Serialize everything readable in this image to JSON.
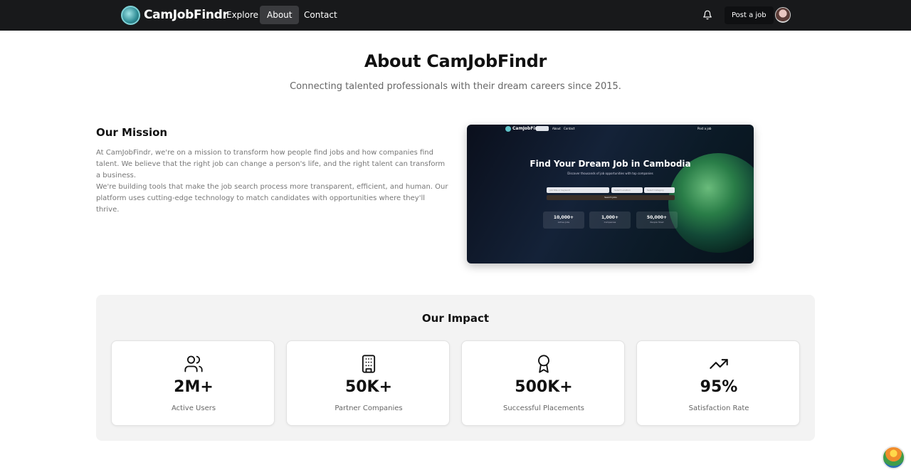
{
  "nav": {
    "brand": "CamJobFindr",
    "links": [
      "Explore",
      "About",
      "Contact"
    ],
    "post_job": "Post a job"
  },
  "header": {
    "title": "About CamJobFindr",
    "subtitle": "Connecting talented professionals with their dream careers since 2015."
  },
  "mission": {
    "heading": "Our Mission",
    "paragraphs": [
      "At CamJobFindr, we're on a mission to transform how people find jobs and how companies find talent. We believe that the right job can change a person's life, and the right talent can transform a business.",
      "We're building tools that make the job search process more transparent, efficient, and human. Our platform uses cutting-edge technology to match candidates with opportunities where they'll thrive."
    ]
  },
  "preview": {
    "brand": "CamJobFindr",
    "nav_links": [
      "About",
      "Contact"
    ],
    "post_job": "Post a job",
    "hero_title": "Find Your Dream Job in Cambodia",
    "hero_subtitle": "Discover thousands of job opportunities with top companies",
    "search_placeholder": "Job title or keyword",
    "location_select": "Select Location",
    "category_select": "Select Category",
    "search_button": "Search Jobs",
    "stats": [
      {
        "value": "10,000+",
        "label": "Active Jobs"
      },
      {
        "value": "1,000+",
        "label": "Companies"
      },
      {
        "value": "50,000+",
        "label": "People Hired"
      }
    ]
  },
  "impact": {
    "heading": "Our Impact",
    "stats": [
      {
        "icon": "users-icon",
        "value": "2M+",
        "label": "Active Users"
      },
      {
        "icon": "building-icon",
        "value": "50K+",
        "label": "Partner Companies"
      },
      {
        "icon": "award-icon",
        "value": "500K+",
        "label": "Successful Placements"
      },
      {
        "icon": "trending-up-icon",
        "value": "95%",
        "label": "Satisfaction Rate"
      }
    ]
  },
  "colors": {
    "nav_bg": "#18191b",
    "impact_bg": "#f3f3f3",
    "text_muted": "#666666"
  }
}
